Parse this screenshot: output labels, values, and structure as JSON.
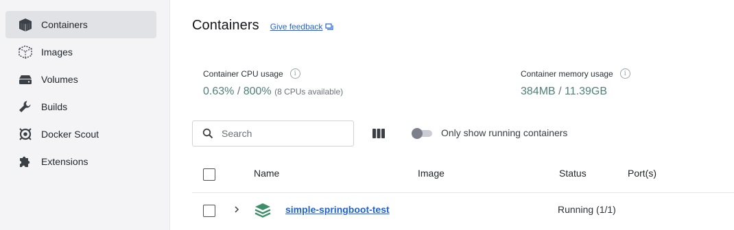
{
  "sidebar": {
    "items": [
      {
        "label": "Containers",
        "icon": "container-icon",
        "active": true
      },
      {
        "label": "Images",
        "icon": "image-icon",
        "active": false
      },
      {
        "label": "Volumes",
        "icon": "volume-icon",
        "active": false
      },
      {
        "label": "Builds",
        "icon": "wrench-icon",
        "active": false
      },
      {
        "label": "Docker Scout",
        "icon": "scout-icon",
        "active": false
      },
      {
        "label": "Extensions",
        "icon": "puzzle-icon",
        "active": false
      }
    ]
  },
  "header": {
    "title": "Containers",
    "feedback_label": "Give feedback"
  },
  "stats": {
    "cpu": {
      "label": "Container CPU usage",
      "used": "0.63%",
      "separator": " / ",
      "total": "800%",
      "note": "(8 CPUs available)"
    },
    "memory": {
      "label": "Container memory usage",
      "used": "384MB",
      "separator": " / ",
      "total": "11.39GB"
    },
    "value_color": "#4c7f76"
  },
  "toolbar": {
    "search_placeholder": "Search",
    "toggle_label": "Only show running containers",
    "toggle_on": false
  },
  "table": {
    "columns": [
      "Name",
      "Image",
      "Status",
      "Port(s)"
    ],
    "rows": [
      {
        "name": "simple-springboot-test",
        "image": "",
        "status": "Running (1/1)",
        "ports": "",
        "icon": "stack-icon"
      }
    ]
  },
  "colors": {
    "link": "#1c62d4",
    "accent_green": "#3e8e6a",
    "sidebar_active_bg": "#e1e2e6"
  }
}
